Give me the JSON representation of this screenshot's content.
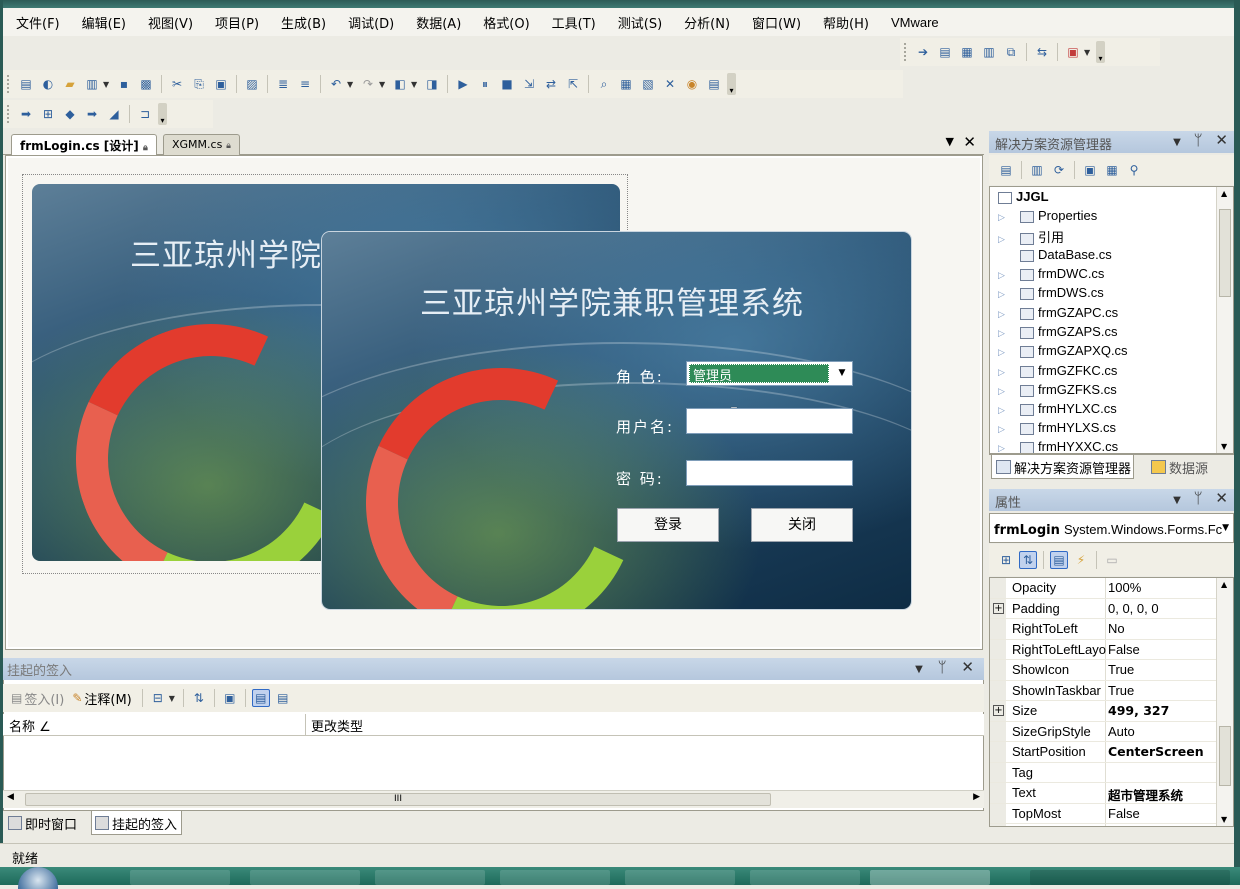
{
  "menubar": {
    "items": [
      "文件(F)",
      "编辑(E)",
      "视图(V)",
      "项目(P)",
      "生成(B)",
      "调试(D)",
      "数据(A)",
      "格式(O)",
      "工具(T)",
      "测试(S)",
      "分析(N)",
      "窗口(W)",
      "帮助(H)",
      "VMware"
    ]
  },
  "tabs": {
    "active": "frmLogin.cs [设计]",
    "inactive": "XGMM.cs"
  },
  "form_designer": {
    "app_title": "三亚琼州学院兼职管理系统",
    "app_title_partial": "三亚琼州学院",
    "role_label": "角  色:",
    "role_value": "管理员",
    "username_label": "用户名:",
    "password_label": "密  码:",
    "login_button": "登录",
    "close_button": "关闭"
  },
  "pending": {
    "title": "挂起的签入",
    "checkin_label": "签入(I)",
    "comment_label": "注释(M)",
    "col_name": "名称",
    "col_change": "更改类型",
    "hscroll_grip": "III"
  },
  "bottom_tabs": {
    "immediate": "即时窗口",
    "pending": "挂起的签入"
  },
  "solution_explorer": {
    "title": "解决方案资源管理器",
    "root": "JJGL",
    "items": [
      "Properties",
      "引用",
      "DataBase.cs",
      "frmDWC.cs",
      "frmDWS.cs",
      "frmGZAPC.cs",
      "frmGZAPS.cs",
      "frmGZAPXQ.cs",
      "frmGZFKC.cs",
      "frmGZFKS.cs",
      "frmHYLXC.cs",
      "frmHYLXS.cs",
      "frmHYXXC.cs"
    ],
    "tab_solution": "解决方案资源管理器",
    "tab_data": "数据源"
  },
  "properties": {
    "title": "属性",
    "object_name": "frmLogin",
    "object_type": "System.Windows.Forms.Fc",
    "rows": [
      {
        "name": "Opacity",
        "value": "100%"
      },
      {
        "name": "Padding",
        "value": "0, 0, 0, 0"
      },
      {
        "name": "RightToLeft",
        "value": "No"
      },
      {
        "name": "RightToLeftLayout",
        "value": "False"
      },
      {
        "name": "ShowIcon",
        "value": "True"
      },
      {
        "name": "ShowInTaskbar",
        "value": "True"
      },
      {
        "name": "Size",
        "value": "499, 327"
      },
      {
        "name": "SizeGripStyle",
        "value": "Auto"
      },
      {
        "name": "StartPosition",
        "value": "CenterScreen"
      },
      {
        "name": "Tag",
        "value": ""
      },
      {
        "name": "Text",
        "value": "超市管理系统"
      },
      {
        "name": "TopMost",
        "value": "False"
      }
    ]
  },
  "status": {
    "text": "就绪"
  },
  "icons": {
    "close": "close-icon",
    "pin": "pin-icon",
    "dropdown": "chevron-down-icon"
  }
}
